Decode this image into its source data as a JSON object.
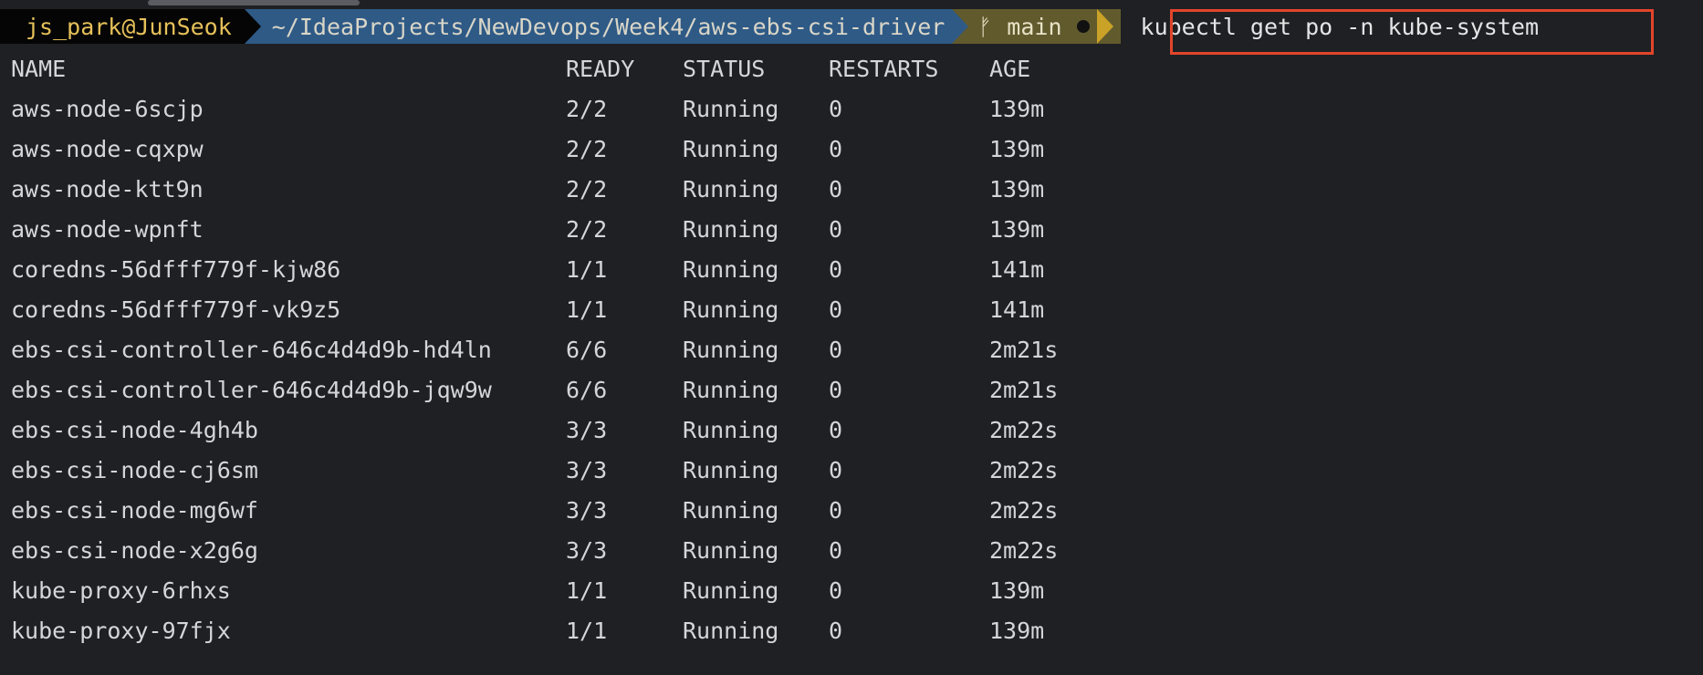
{
  "prompt": {
    "user": "js_park@JunSeok",
    "path": "~/IdeaProjects/NewDevops/Week4/aws-ebs-csi-driver",
    "branch_icon": "git-branch-icon",
    "branch": "main",
    "command": "kubectl get po -n kube-system",
    "colors": {
      "user_bg": "#050505",
      "user_fg": "#e6c15a",
      "path_bg": "#2f5a86",
      "git_bg": "#615a2d",
      "highlight": "#e2452b"
    }
  },
  "table": {
    "headers": {
      "name": "NAME",
      "ready": "READY",
      "status": "STATUS",
      "restarts": "RESTARTS",
      "age": "AGE"
    },
    "rows": [
      {
        "name": "aws-node-6scjp",
        "ready": "2/2",
        "status": "Running",
        "restarts": "0",
        "age": "139m"
      },
      {
        "name": "aws-node-cqxpw",
        "ready": "2/2",
        "status": "Running",
        "restarts": "0",
        "age": "139m"
      },
      {
        "name": "aws-node-ktt9n",
        "ready": "2/2",
        "status": "Running",
        "restarts": "0",
        "age": "139m"
      },
      {
        "name": "aws-node-wpnft",
        "ready": "2/2",
        "status": "Running",
        "restarts": "0",
        "age": "139m"
      },
      {
        "name": "coredns-56dfff779f-kjw86",
        "ready": "1/1",
        "status": "Running",
        "restarts": "0",
        "age": "141m"
      },
      {
        "name": "coredns-56dfff779f-vk9z5",
        "ready": "1/1",
        "status": "Running",
        "restarts": "0",
        "age": "141m"
      },
      {
        "name": "ebs-csi-controller-646c4d4d9b-hd4ln",
        "ready": "6/6",
        "status": "Running",
        "restarts": "0",
        "age": "2m21s"
      },
      {
        "name": "ebs-csi-controller-646c4d4d9b-jqw9w",
        "ready": "6/6",
        "status": "Running",
        "restarts": "0",
        "age": "2m21s"
      },
      {
        "name": "ebs-csi-node-4gh4b",
        "ready": "3/3",
        "status": "Running",
        "restarts": "0",
        "age": "2m22s"
      },
      {
        "name": "ebs-csi-node-cj6sm",
        "ready": "3/3",
        "status": "Running",
        "restarts": "0",
        "age": "2m22s"
      },
      {
        "name": "ebs-csi-node-mg6wf",
        "ready": "3/3",
        "status": "Running",
        "restarts": "0",
        "age": "2m22s"
      },
      {
        "name": "ebs-csi-node-x2g6g",
        "ready": "3/3",
        "status": "Running",
        "restarts": "0",
        "age": "2m22s"
      },
      {
        "name": "kube-proxy-6rhxs",
        "ready": "1/1",
        "status": "Running",
        "restarts": "0",
        "age": "139m"
      },
      {
        "name": "kube-proxy-97fjx",
        "ready": "1/1",
        "status": "Running",
        "restarts": "0",
        "age": "139m"
      }
    ]
  }
}
